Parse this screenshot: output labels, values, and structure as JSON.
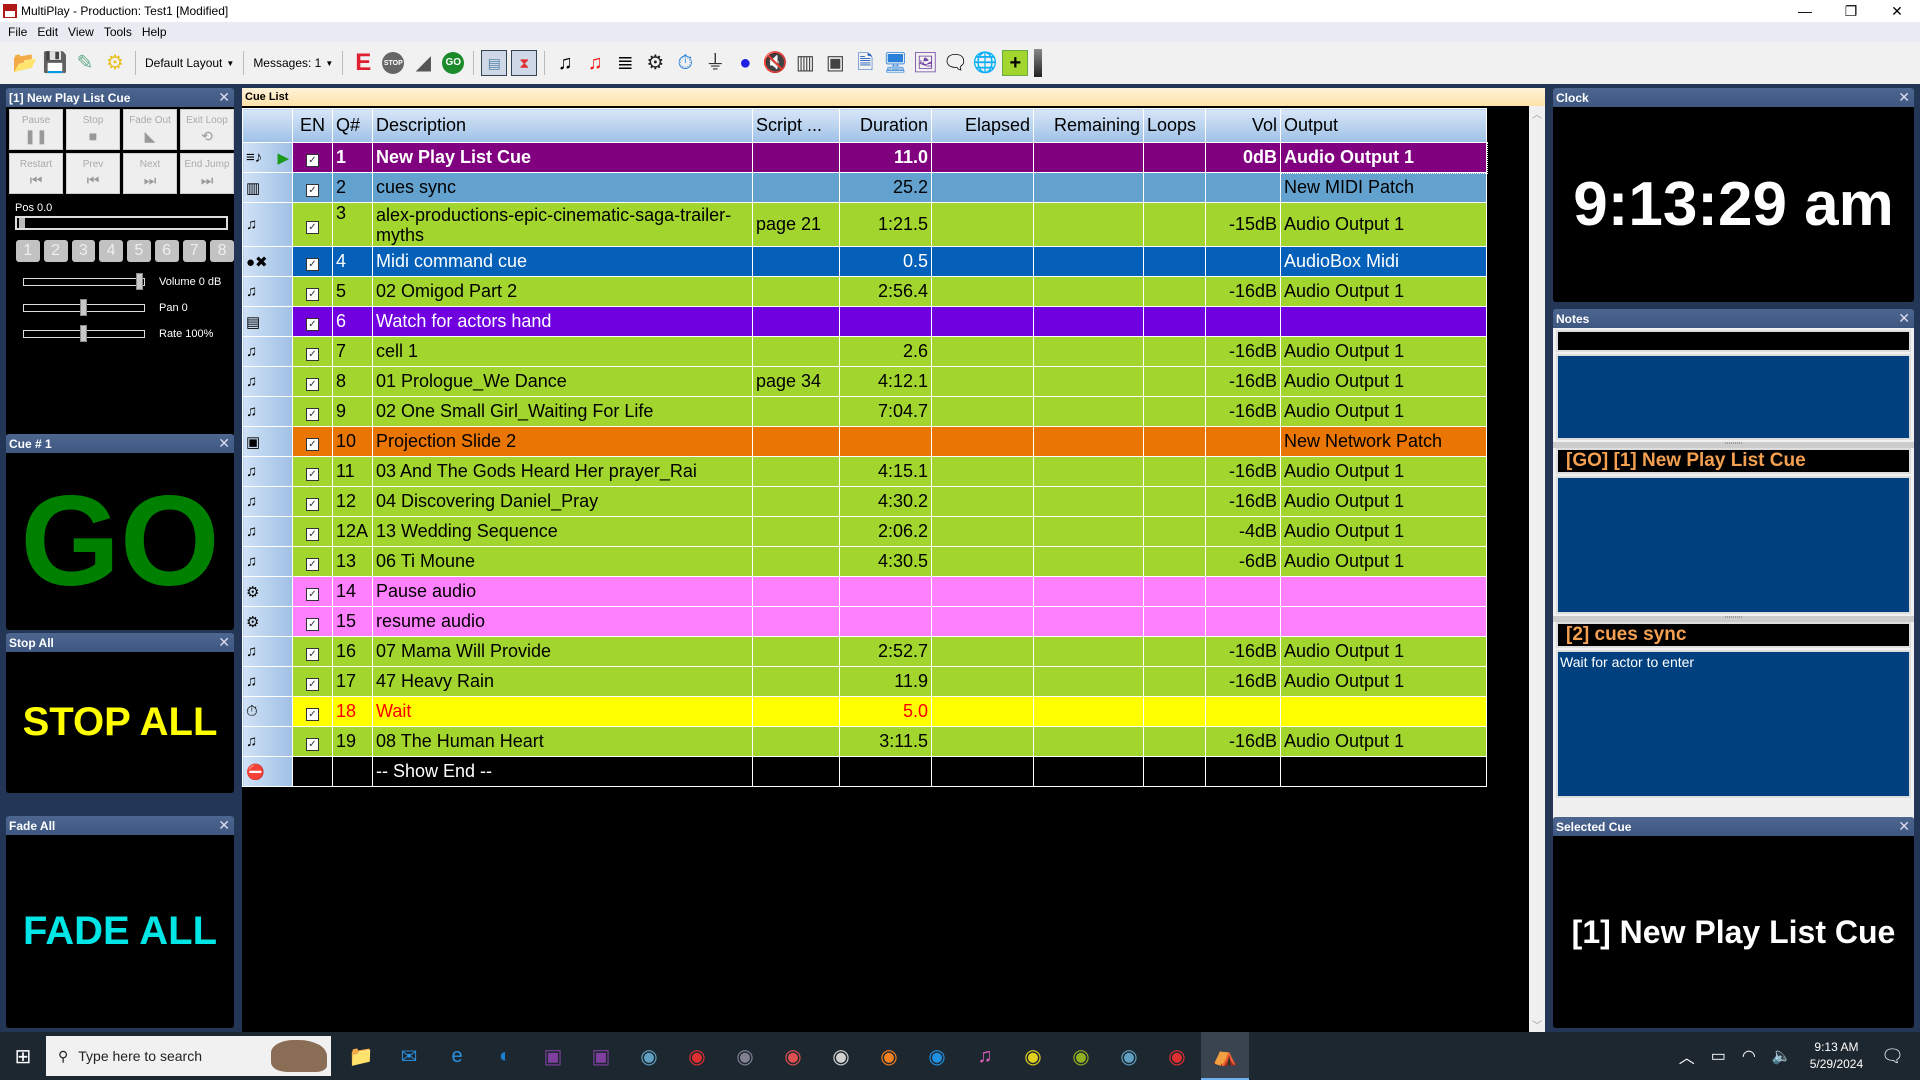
{
  "window": {
    "title": "MultiPlay - Production: Test1 [Modified]",
    "controls": [
      "minimize",
      "restore",
      "close"
    ]
  },
  "menu": [
    "File",
    "Edit",
    "View",
    "Tools",
    "Help"
  ],
  "toolbar": {
    "layout_dropdown": "Default Layout",
    "messages_dropdown": "Messages: 1",
    "icons": [
      "open-folder",
      "save",
      "edit-note",
      "settings-gear",
      "e-edit",
      "stop",
      "fade",
      "go",
      "list-view",
      "collapse",
      "audio-cue",
      "audio-cue-red",
      "playlist-cue",
      "control-cue",
      "wait-cue",
      "usb-cue",
      "midi-cue",
      "mute-cue",
      "midi-piano",
      "network-cue",
      "text-cue",
      "video-cue",
      "image-cue",
      "notes-cue",
      "web-cue",
      "add-cue"
    ]
  },
  "active_cue_panel": {
    "title": "[1] New Play List Cue",
    "buttons": [
      {
        "label": "Pause",
        "glyph": "❚❚"
      },
      {
        "label": "Stop",
        "glyph": "■"
      },
      {
        "label": "Fade Out",
        "glyph": "◣"
      },
      {
        "label": "Exit Loop",
        "glyph": "⟲"
      },
      {
        "label": "Restart",
        "glyph": "⏮"
      },
      {
        "label": "Prev",
        "glyph": "⏮"
      },
      {
        "label": "Next",
        "glyph": "⏭"
      },
      {
        "label": "End Jump",
        "glyph": "⏭"
      }
    ],
    "pos_label": "Pos 0.0",
    "position": 0.0,
    "numbers": [
      "1",
      "2",
      "3",
      "4",
      "5",
      "6",
      "7",
      "8"
    ],
    "volume": {
      "label": "Volume 0 dB",
      "value": 1.0
    },
    "pan": {
      "label": "Pan 0",
      "value": 0.5
    },
    "rate": {
      "label": "Rate 100%",
      "value": 0.5
    }
  },
  "cue_panel": {
    "title": "Cue # 1",
    "text": "GO",
    "color": "#008000"
  },
  "stop_all_panel": {
    "title": "Stop All",
    "text": "STOP ALL",
    "color": "#ffff00"
  },
  "fade_all_panel": {
    "title": "Fade All",
    "text": "FADE ALL",
    "color": "#00e5e5"
  },
  "cue_list": {
    "title": "Cue List",
    "columns": [
      "",
      "EN",
      "Q#",
      "Description",
      "Script ...",
      "Duration",
      "Elapsed",
      "Remaining",
      "Loops",
      "Vol",
      "Output"
    ],
    "rows": [
      {
        "icon": "playlist-icon",
        "glyph": "≡♪",
        "playing": true,
        "en": true,
        "q": "1",
        "desc": "New Play List Cue",
        "script": "",
        "dur": "11.0",
        "elapsed": "",
        "remaining": "",
        "loops": "",
        "vol": "0dB",
        "output": "Audio Output 1",
        "bg": "#800080",
        "fg": "#ffffff",
        "bold": true
      },
      {
        "icon": "midi-piano-icon",
        "glyph": "▥",
        "en": true,
        "q": "2",
        "desc": "cues sync",
        "script": "",
        "dur": "25.2",
        "elapsed": "",
        "remaining": "",
        "loops": "",
        "vol": "",
        "output": "New MIDI Patch",
        "bg": "#63a2cf",
        "fg": "#000000"
      },
      {
        "icon": "audio-icon",
        "glyph": "♫",
        "en": true,
        "q": "3",
        "desc": "alex-productions-epic-cinematic-saga-trailer-myths",
        "script": "page 21",
        "dur": "1:21.5",
        "elapsed": "",
        "remaining": "",
        "loops": "",
        "vol": "-15dB",
        "output": "Audio Output 1",
        "bg": "#a2d62e",
        "fg": "#000000",
        "tall": true
      },
      {
        "icon": "midi-command-icon",
        "glyph": "●✖",
        "en": true,
        "q": "4",
        "desc": "Midi command cue",
        "script": "",
        "dur": "0.5",
        "elapsed": "",
        "remaining": "",
        "loops": "",
        "vol": "",
        "output": "AudioBox Midi",
        "bg": "#0460b8",
        "fg": "#ffffff"
      },
      {
        "icon": "audio-icon",
        "glyph": "♫",
        "en": true,
        "q": "5",
        "desc": "02 Omigod Part 2",
        "script": "",
        "dur": "2:56.4",
        "elapsed": "",
        "remaining": "",
        "loops": "",
        "vol": "-16dB",
        "output": "Audio Output 1",
        "bg": "#a2d62e",
        "fg": "#000000"
      },
      {
        "icon": "text-cue-icon",
        "glyph": "▤",
        "en": true,
        "q": "6",
        "desc": "Watch for actors hand",
        "script": "",
        "dur": "",
        "elapsed": "",
        "remaining": "",
        "loops": "",
        "vol": "",
        "output": "",
        "bg": "#7000e0",
        "fg": "#ffffff"
      },
      {
        "icon": "audio-icon",
        "glyph": "♫",
        "en": true,
        "q": "7",
        "desc": "cell 1",
        "script": "",
        "dur": "2.6",
        "elapsed": "",
        "remaining": "",
        "loops": "",
        "vol": "-16dB",
        "output": "Audio Output 1",
        "bg": "#a2d62e",
        "fg": "#000000"
      },
      {
        "icon": "audio-icon",
        "glyph": "♫",
        "en": true,
        "q": "8",
        "desc": "01 Prologue_We Dance",
        "script": "page 34",
        "dur": "4:12.1",
        "elapsed": "",
        "remaining": "",
        "loops": "",
        "vol": "-16dB",
        "output": "Audio Output 1",
        "bg": "#a2d62e",
        "fg": "#000000"
      },
      {
        "icon": "audio-icon",
        "glyph": "♫",
        "en": true,
        "q": "9",
        "desc": "02 One Small Girl_Waiting For Life",
        "script": "",
        "dur": "7:04.7",
        "elapsed": "",
        "remaining": "",
        "loops": "",
        "vol": "-16dB",
        "output": "Audio Output 1",
        "bg": "#a2d62e",
        "fg": "#000000"
      },
      {
        "icon": "network-icon",
        "glyph": "▣",
        "en": true,
        "q": "10",
        "desc": "Projection Slide 2",
        "script": "",
        "dur": "",
        "elapsed": "",
        "remaining": "",
        "loops": "",
        "vol": "",
        "output": "New Network Patch",
        "bg": "#e87504",
        "fg": "#000000"
      },
      {
        "icon": "audio-icon",
        "glyph": "♫",
        "en": true,
        "q": "11",
        "desc": "03 And The Gods Heard Her prayer_Rai",
        "script": "",
        "dur": "4:15.1",
        "elapsed": "",
        "remaining": "",
        "loops": "",
        "vol": "-16dB",
        "output": "Audio Output 1",
        "bg": "#a2d62e",
        "fg": "#000000"
      },
      {
        "icon": "audio-icon",
        "glyph": "♫",
        "en": true,
        "q": "12",
        "desc": "04 Discovering Daniel_Pray",
        "script": "",
        "dur": "4:30.2",
        "elapsed": "",
        "remaining": "",
        "loops": "",
        "vol": "-16dB",
        "output": "Audio Output 1",
        "bg": "#a2d62e",
        "fg": "#000000"
      },
      {
        "icon": "audio-icon",
        "glyph": "♫",
        "en": true,
        "q": "12A",
        "desc": "13 Wedding Sequence",
        "script": "",
        "dur": "2:06.2",
        "elapsed": "",
        "remaining": "",
        "loops": "",
        "vol": "-4dB",
        "output": "Audio Output 1",
        "bg": "#a2d62e",
        "fg": "#000000"
      },
      {
        "icon": "audio-icon",
        "glyph": "♫",
        "en": true,
        "q": "13",
        "desc": "06 Ti Moune",
        "script": "",
        "dur": "4:30.5",
        "elapsed": "",
        "remaining": "",
        "loops": "",
        "vol": "-6dB",
        "output": "Audio Output 1",
        "bg": "#a2d62e",
        "fg": "#000000"
      },
      {
        "icon": "control-icon",
        "glyph": "⚙",
        "en": true,
        "q": "14",
        "desc": "Pause audio",
        "script": "",
        "dur": "",
        "elapsed": "",
        "remaining": "",
        "loops": "",
        "vol": "",
        "output": "",
        "bg": "#ff80ff",
        "fg": "#000000"
      },
      {
        "icon": "control-icon",
        "glyph": "⚙",
        "en": true,
        "q": "15",
        "desc": "resume audio",
        "script": "",
        "dur": "",
        "elapsed": "",
        "remaining": "",
        "loops": "",
        "vol": "",
        "output": "",
        "bg": "#ff80ff",
        "fg": "#000000"
      },
      {
        "icon": "audio-icon",
        "glyph": "♫",
        "en": true,
        "q": "16",
        "desc": "07 Mama Will Provide",
        "script": "",
        "dur": "2:52.7",
        "elapsed": "",
        "remaining": "",
        "loops": "",
        "vol": "-16dB",
        "output": "Audio Output 1",
        "bg": "#a2d62e",
        "fg": "#000000"
      },
      {
        "icon": "audio-icon",
        "glyph": "♫",
        "en": true,
        "q": "17",
        "desc": "47 Heavy Rain",
        "script": "",
        "dur": "11.9",
        "elapsed": "",
        "remaining": "",
        "loops": "",
        "vol": "-16dB",
        "output": "Audio Output 1",
        "bg": "#a2d62e",
        "fg": "#000000"
      },
      {
        "icon": "wait-stopwatch-icon",
        "glyph": "⏱",
        "en": true,
        "q": "18",
        "desc": "Wait",
        "script": "",
        "dur": "5.0",
        "elapsed": "",
        "remaining": "",
        "loops": "",
        "vol": "",
        "output": "",
        "bg": "#ffff00",
        "fg": "#ff0000"
      },
      {
        "icon": "audio-icon",
        "glyph": "♫",
        "en": true,
        "q": "19",
        "desc": "08 The Human Heart",
        "script": "",
        "dur": "3:11.5",
        "elapsed": "",
        "remaining": "",
        "loops": "",
        "vol": "-16dB",
        "output": "Audio Output 1",
        "bg": "#a2d62e",
        "fg": "#000000"
      },
      {
        "icon": "show-end-icon",
        "glyph": "⛔",
        "en": null,
        "q": "",
        "desc": "-- Show End --",
        "script": "",
        "dur": "",
        "elapsed": "",
        "remaining": "",
        "loops": "",
        "vol": "",
        "output": "",
        "bg": "#000000",
        "fg": "#ffffff"
      }
    ]
  },
  "clock_panel": {
    "title": "Clock",
    "time": "9:13:29 am"
  },
  "notes_panel": {
    "title": "Notes",
    "sections": [
      {
        "header": "",
        "body": ""
      },
      {
        "header": "[GO] [1] New Play List Cue",
        "body": ""
      },
      {
        "header": "[2] cues sync",
        "body": "Wait for actor to enter"
      }
    ]
  },
  "selected_cue_panel": {
    "title": "Selected Cue",
    "text": "[1] New Play List Cue"
  },
  "taskbar": {
    "search_placeholder": "Type here to search",
    "apps": [
      "file-explorer",
      "mail",
      "internet-explorer",
      "edge",
      "teams-record",
      "teams-play",
      "app-7",
      "app-8",
      "app-9",
      "app-10",
      "app-11",
      "app-12",
      "app-13",
      "itunes",
      "app-15",
      "app-16",
      "app-17",
      "app-18",
      "multiplay"
    ],
    "time": "9:13 AM",
    "date": "5/29/2024"
  }
}
